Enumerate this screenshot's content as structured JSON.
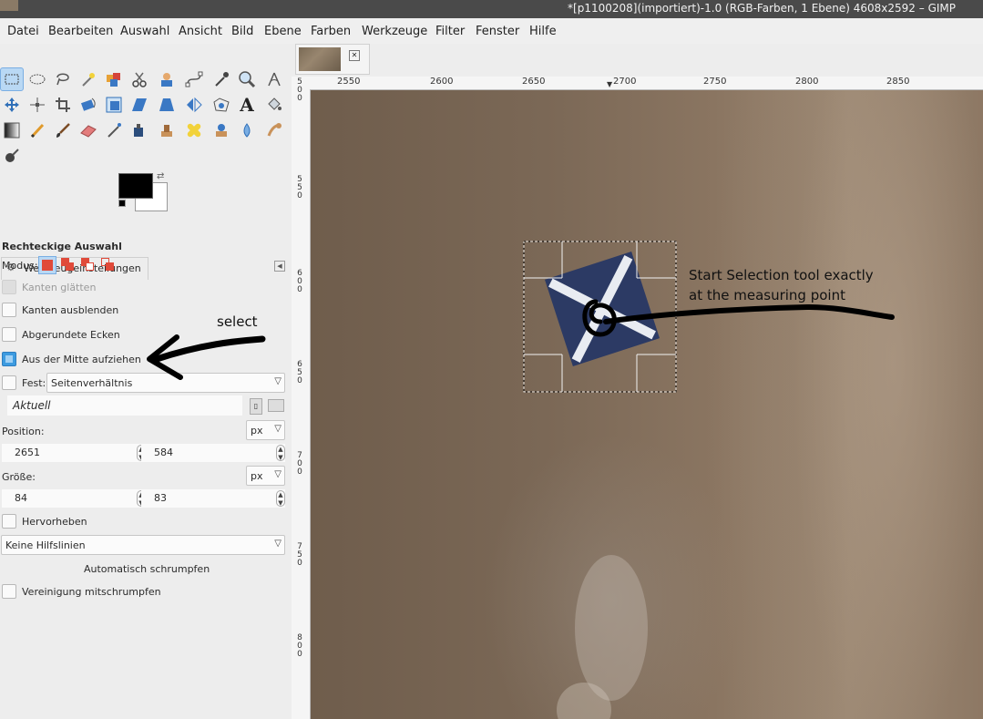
{
  "window": {
    "title": "*[p1100208](importiert)-1.0 (RGB-Farben, 1 Ebene) 4608x2592 – GIMP"
  },
  "menu": [
    "Datei",
    "Bearbeiten",
    "Auswahl",
    "Ansicht",
    "Bild",
    "Ebene",
    "Farben",
    "Werkzeuge",
    "Filter",
    "Fenster",
    "Hilfe"
  ],
  "tools": [
    "rect-select-icon",
    "ellipse-select-icon",
    "lasso-icon",
    "fuzzy-select-icon",
    "color-select-icon",
    "scissors-icon",
    "foreground-select-icon",
    "paths-icon",
    "color-picker-icon",
    "zoom-icon",
    "measure-icon",
    "move-icon",
    "align-icon",
    "crop-icon",
    "rotate-icon",
    "scale-icon",
    "shear-icon",
    "perspective-icon",
    "flip-icon",
    "cage-icon",
    "text-icon",
    "bucket-fill-icon",
    "blend-icon",
    "pencil-icon",
    "paintbrush-icon",
    "eraser-icon",
    "airbrush-icon",
    "ink-icon",
    "clone-icon",
    "heal-icon",
    "perspective-clone-icon",
    "blur-icon",
    "smudge-icon",
    "dodge-burn-icon"
  ],
  "colors": {
    "foreground": "#000000",
    "background": "#ffffff",
    "accent": "#3d9be0"
  },
  "tool_options": {
    "tab_label": "Werkzeugeinstellungen",
    "heading": "Rechteckige Auswahl",
    "mode_label": "Modus:",
    "antialias_label": "Kanten glätten",
    "feather_label": "Kanten ausblenden",
    "rounded_label": "Abgerundete Ecken",
    "expand_center_label": "Aus der Mitte aufziehen",
    "fixed_label": "Fest:",
    "fixed_value": "Seitenverhältnis",
    "current_label": "Aktuell",
    "position_label": "Position:",
    "position_unit": "px",
    "position_x": "2651",
    "position_y": "584",
    "size_label": "Größe:",
    "size_unit": "px",
    "size_w": "84",
    "size_h": "83",
    "highlight_label": "Hervorheben",
    "guides_value": "Keine Hilfslinien",
    "autoshrink_label": "Automatisch schrumpfen",
    "shrink_merged_label": "Vereinigung mitschrumpfen"
  },
  "rulers": {
    "h": [
      "2550",
      "2600",
      "2650",
      "2700",
      "2750",
      "2800",
      "2850"
    ],
    "v": [
      "500",
      "550",
      "600",
      "650",
      "700",
      "750",
      "800"
    ]
  },
  "annotations": {
    "select": "select",
    "instruction_line1": "Start Selection tool exactly",
    "instruction_line2": "at the measuring point"
  }
}
